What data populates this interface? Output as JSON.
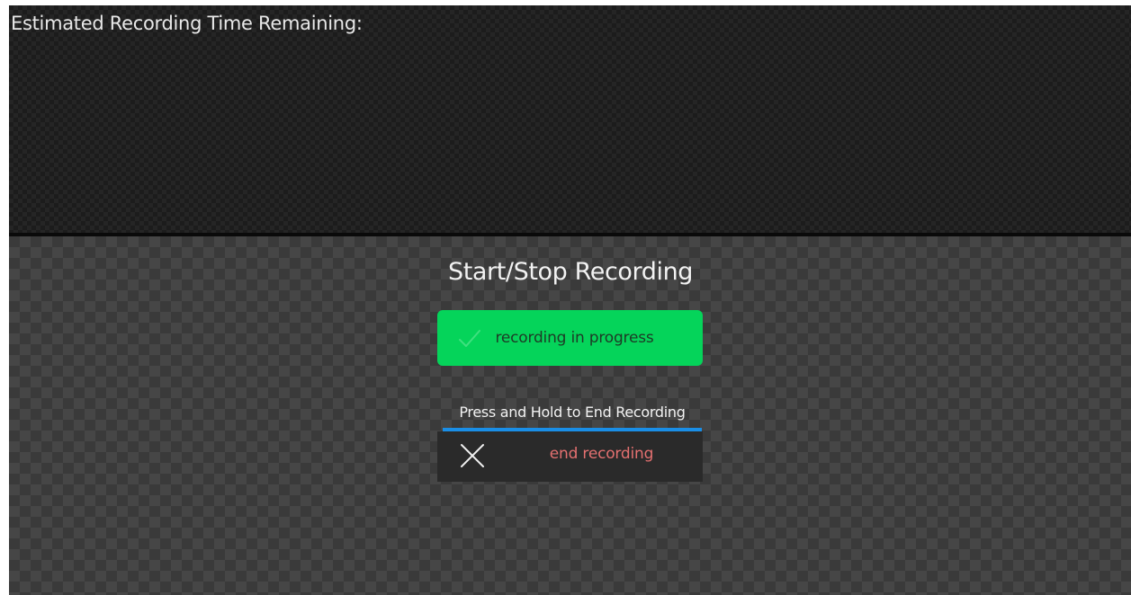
{
  "status_panel": {
    "label": "Estimated Recording Time Remaining:"
  },
  "controls": {
    "title": "Start/Stop Recording",
    "status_button": {
      "label": "recording in progress",
      "icon": "check-icon",
      "color": "#05d45a"
    },
    "hold_instruction": "Press and Hold to End Recording",
    "hold_progress": 1.0,
    "end_button": {
      "label": "end recording",
      "icon": "close-icon",
      "label_color": "#e47070"
    },
    "accent_color": "#1a8ee6"
  }
}
